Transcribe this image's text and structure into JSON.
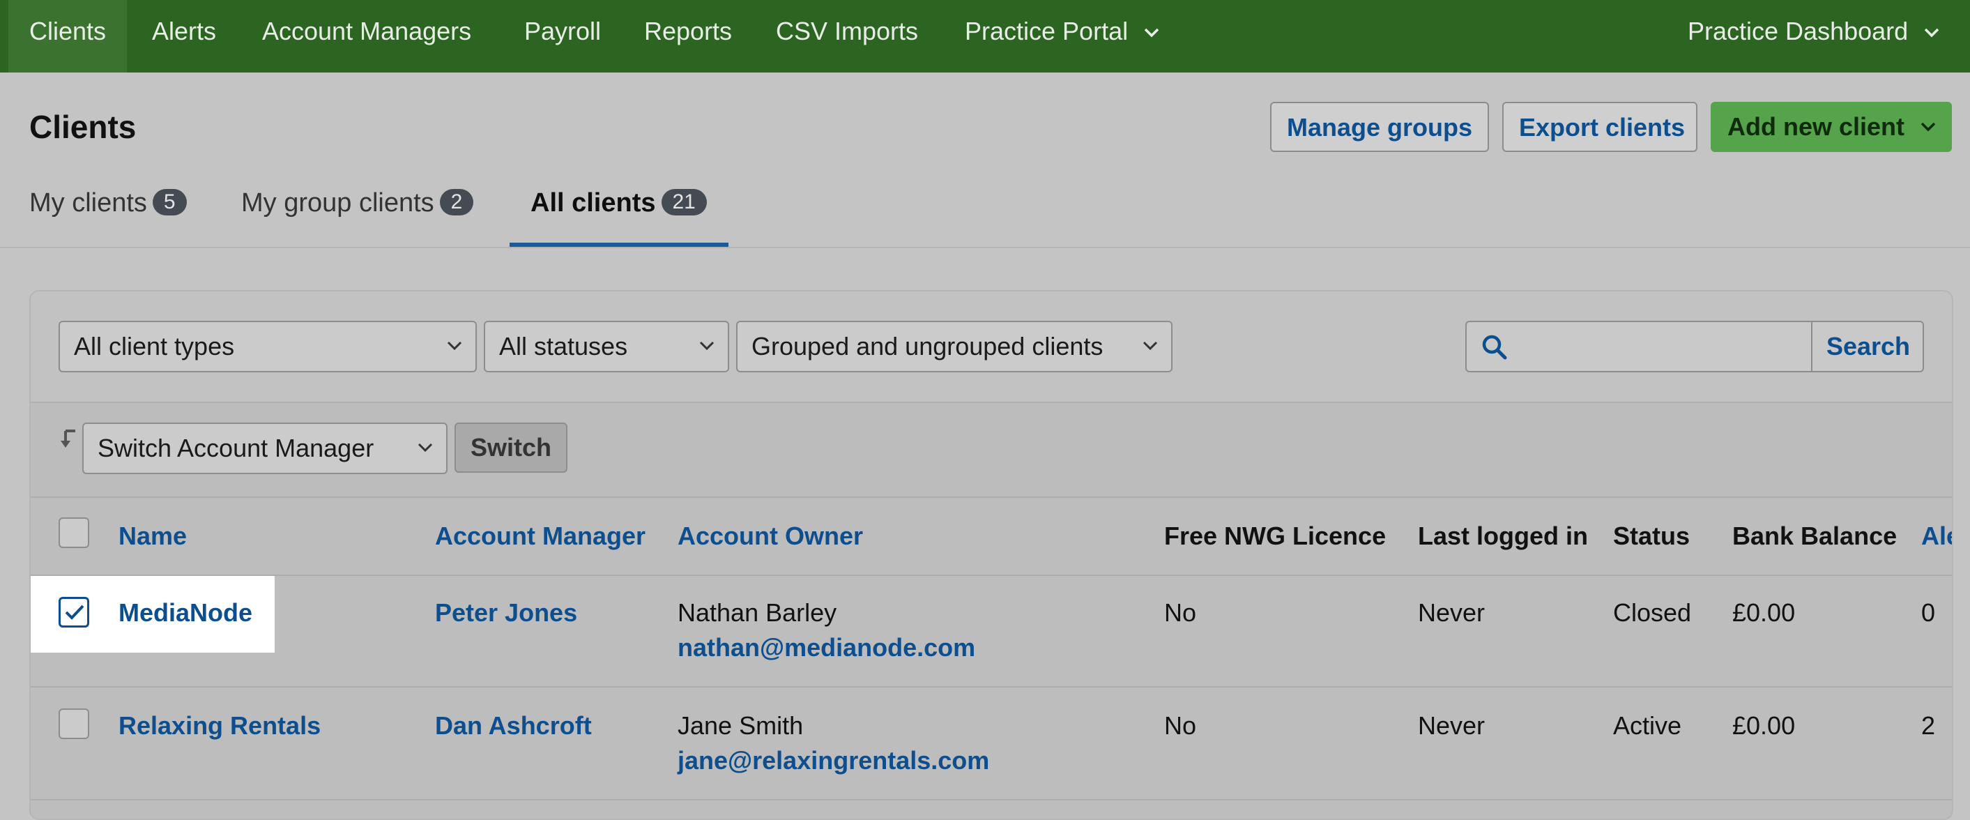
{
  "nav": {
    "items": [
      "Clients",
      "Alerts",
      "Account Managers",
      "Payroll",
      "Reports",
      "CSV Imports",
      "Practice Portal"
    ],
    "right": "Practice Dashboard"
  },
  "header": {
    "title": "Clients",
    "manage_groups": "Manage groups",
    "export_clients": "Export clients",
    "add_new_client": "Add new client"
  },
  "tabs": [
    {
      "label": "My clients",
      "count": "5"
    },
    {
      "label": "My group clients",
      "count": "2"
    },
    {
      "label": "All clients",
      "count": "21",
      "active": true
    }
  ],
  "filters": {
    "client_types": "All client types",
    "statuses": "All statuses",
    "grouping": "Grouped and ungrouped clients",
    "search_placeholder": "",
    "search_button": "Search"
  },
  "bulk": {
    "select": "Switch Account Manager",
    "button": "Switch"
  },
  "table": {
    "columns": [
      "Name",
      "Account Manager",
      "Account Owner",
      "Free NWG Licence",
      "Last logged in",
      "Status",
      "Bank Balance",
      "Ale"
    ],
    "rows": [
      {
        "checked": true,
        "name": "MediaNode",
        "manager": "Peter Jones",
        "owner": "Nathan Barley",
        "email": "nathan@medianode.com",
        "licence": "No",
        "last_logged": "Never",
        "status": "Closed",
        "balance": "£0.00",
        "alerts": "0"
      },
      {
        "checked": false,
        "name": "Relaxing Rentals",
        "manager": "Dan Ashcroft",
        "owner": "Jane Smith",
        "email": "jane@relaxingrentals.com",
        "licence": "No",
        "last_logged": "Never",
        "status": "Active",
        "balance": "£0.00",
        "alerts": "2"
      }
    ]
  },
  "colors": {
    "nav_bg": "#2c6422",
    "link": "#0d4e8f",
    "green_button": "#55a34a"
  }
}
